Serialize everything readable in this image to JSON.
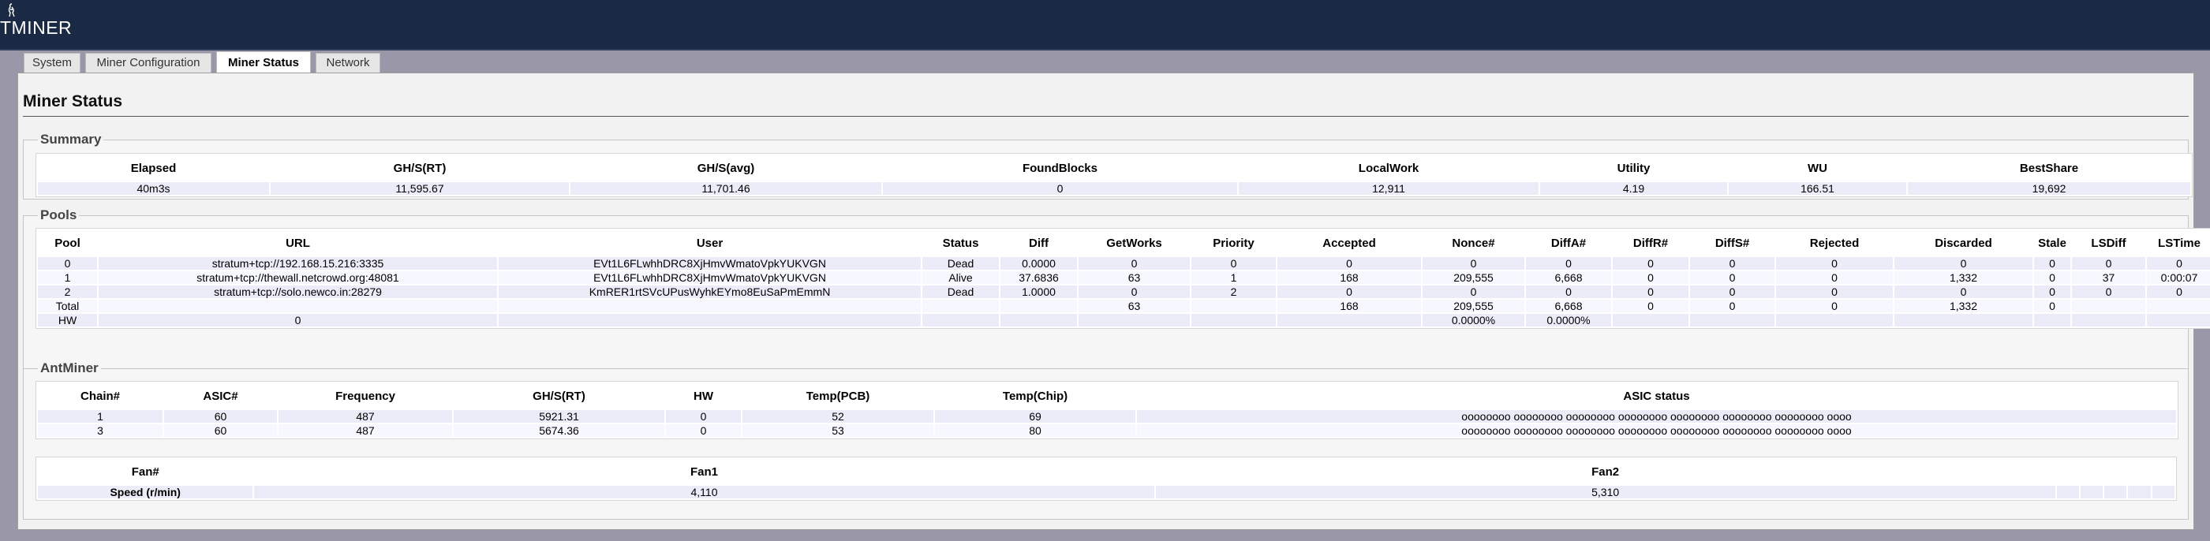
{
  "header": {
    "logo_text": "TMINER"
  },
  "tabs": [
    {
      "label": "System"
    },
    {
      "label": "Miner Configuration"
    },
    {
      "label": "Miner Status"
    },
    {
      "label": "Network"
    }
  ],
  "page": {
    "title": "Miner Status"
  },
  "summary": {
    "legend": "Summary",
    "headers": [
      "Elapsed",
      "GH/S(RT)",
      "GH/S(avg)",
      "FoundBlocks",
      "LocalWork",
      "Utility",
      "WU",
      "BestShare"
    ],
    "row": [
      "40m3s",
      "11,595.67",
      "11,701.46",
      "0",
      "12,911",
      "4.19",
      "166.51",
      "19,692"
    ]
  },
  "pools": {
    "legend": "Pools",
    "headers": [
      "Pool",
      "URL",
      "User",
      "Status",
      "Diff",
      "GetWorks",
      "Priority",
      "Accepted",
      "Nonce#",
      "DiffA#",
      "DiffR#",
      "DiffS#",
      "Rejected",
      "Discarded",
      "Stale",
      "LSDiff",
      "LSTime"
    ],
    "rows": [
      [
        "0",
        "stratum+tcp://192.168.15.216:3335",
        "EVt1L6FLwhhDRC8XjHmvWmatoVpkYUKVGN",
        "Dead",
        "0.0000",
        "0",
        "0",
        "0",
        "0",
        "0",
        "0",
        "0",
        "0",
        "0",
        "0",
        "0",
        "0"
      ],
      [
        "1",
        "stratum+tcp://thewall.netcrowd.org:48081",
        "EVt1L6FLwhhDRC8XjHmvWmatoVpkYUKVGN",
        "Alive",
        "37.6836",
        "63",
        "1",
        "168",
        "209,555",
        "6,668",
        "0",
        "0",
        "0",
        "1,332",
        "0",
        "37",
        "0:00:07"
      ],
      [
        "2",
        "stratum+tcp://solo.newco.in:28279",
        "KmRER1rtSVcUPusWyhkEYmo8EuSaPmEmmN",
        "Dead",
        "1.0000",
        "0",
        "2",
        "0",
        "0",
        "0",
        "0",
        "0",
        "0",
        "0",
        "0",
        "0",
        "0"
      ],
      [
        "Total",
        "",
        "",
        "",
        "",
        "63",
        "",
        "168",
        "209,555",
        "6,668",
        "0",
        "0",
        "0",
        "1,332",
        "0",
        "",
        ""
      ],
      [
        "HW",
        "0",
        "",
        "",
        "",
        "",
        "",
        "",
        "0.0000%",
        "0.0000%",
        "",
        "",
        "",
        "",
        "",
        "",
        ""
      ]
    ]
  },
  "antminer": {
    "legend": "AntMiner",
    "headers": [
      "Chain#",
      "ASIC#",
      "Frequency",
      "GH/S(RT)",
      "HW",
      "Temp(PCB)",
      "Temp(Chip)",
      "ASIC status"
    ],
    "rows": [
      [
        "1",
        "60",
        "487",
        "5921.31",
        "0",
        "52",
        "69",
        "oooooooo oooooooo oooooooo oooooooo oooooooo oooooooo oooooooo oooo"
      ],
      [
        "3",
        "60",
        "487",
        "5674.36",
        "0",
        "53",
        "80",
        "oooooooo oooooooo oooooooo oooooooo oooooooo oooooooo oooooooo oooo"
      ]
    ],
    "fans": {
      "headers": [
        "Fan#",
        "Fan1",
        "Fan2"
      ],
      "row": [
        "Speed (r/min)",
        "4,110",
        "5,310"
      ]
    }
  }
}
